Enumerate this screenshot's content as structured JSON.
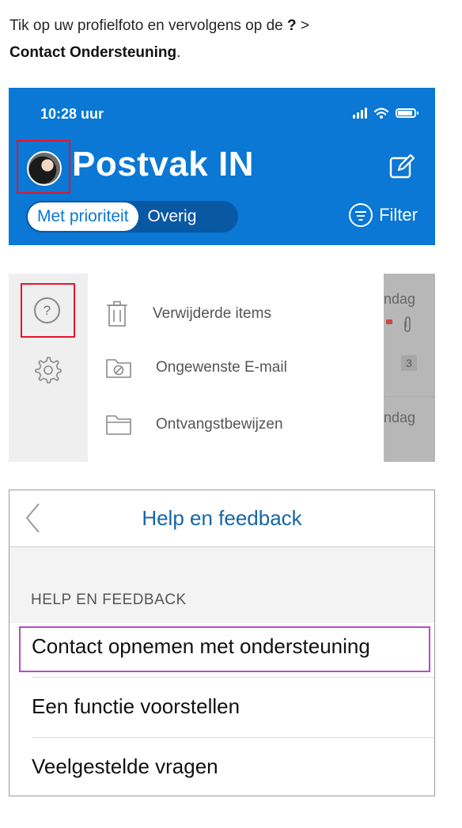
{
  "intro": {
    "line1": "Tik op uw profielfoto en vervolgens op de",
    "line1_bold": "?",
    "line1_suffix": ">",
    "line2_bold": "Contact Ondersteuning",
    "line2_suffix": "."
  },
  "outlook_header": {
    "time": "10:28 uur",
    "title": "Postvak IN",
    "tab_focused": "Met prioriteit",
    "tab_other": "Overig",
    "filter_label": "Filter",
    "colors": {
      "header_blue": "#0a78d4",
      "highlight_red": "#e8132b"
    }
  },
  "side_menu": {
    "items": [
      {
        "label": "Verwijderde items",
        "icon": "trash-icon"
      },
      {
        "label": "Ongewenste E-mail",
        "icon": "junk-folder-icon"
      },
      {
        "label": "Ontvangstbewijzen",
        "icon": "folder-icon"
      }
    ],
    "overlay": {
      "day_top": "ndag",
      "day_bottom": "ndag",
      "badge": "3"
    }
  },
  "help_feedback": {
    "title": "Help en feedback",
    "section_header": "HELP EN FEEDBACK",
    "rows": [
      "Contact opnemen met ondersteuning",
      "Een functie voorstellen",
      "Veelgestelde vragen"
    ],
    "colors": {
      "title_blue": "#1566a6",
      "highlight_purple": "#b24ec6"
    }
  }
}
